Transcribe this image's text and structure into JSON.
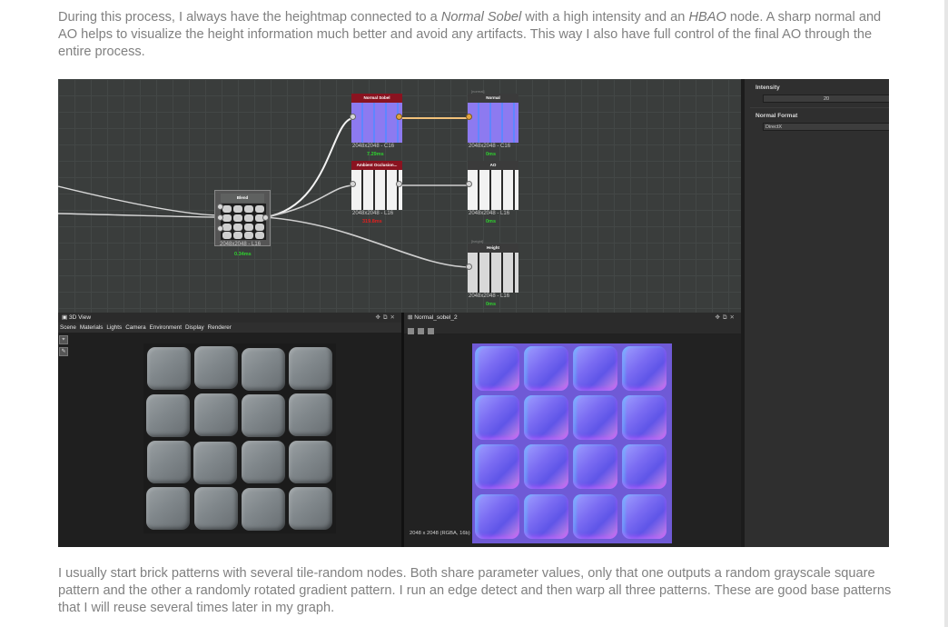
{
  "article": {
    "p1_pre": "During this process, I always have the heightmap connected to a ",
    "p1_em1": "Normal Sobel",
    "p1_mid": " with a high intensity and an ",
    "p1_em2": "HBAO",
    "p1_post": " node. A sharp normal and AO helps to visualize the height information much better and avoid any artifacts. This way I also have full control of the final AO through the entire process.",
    "p2": "I usually start brick patterns with several tile-random nodes. Both share parameter values, only that one outputs a random grayscale square pattern and the other a randomly rotated gradient pattern. I run an edge detect and then warp all three patterns. These are good base patterns that I will reuse several times later in my graph."
  },
  "graph": {
    "nodes": {
      "blend": {
        "title": "Blend",
        "res": "2048x2048 - L16",
        "time": "0.34ms"
      },
      "normal_sobel": {
        "title": "Normal Sobel",
        "res": "2048x2048 - C16",
        "time": "7.29ms"
      },
      "normal_out": {
        "title": "Normal",
        "tag": "[normal]",
        "res": "2048x2048 - C16",
        "time": "0ms"
      },
      "hbao": {
        "title": "Ambient Occlusion...",
        "res": "2048x2048 - L16",
        "time": "319.8ms"
      },
      "ao_out": {
        "title": "AO",
        "res": "2048x2048 - L16",
        "time": "0ms"
      },
      "height_out": {
        "title": "Height",
        "tag": "[height]",
        "res": "2048x2048 - L16",
        "time": "0ms"
      }
    },
    "colors": {
      "time_ok": "#2fd12f",
      "time_slow": "#e02020",
      "wire": "#e8e8e8",
      "wire_color": "#f2c27a"
    }
  },
  "params": {
    "intensity_label": "Intensity",
    "intensity_value": "20",
    "normal_format_label": "Normal Format",
    "normal_format_value": "DirectX"
  },
  "view3d": {
    "title": "3D View",
    "menu": [
      "Scene",
      "Materials",
      "Lights",
      "Camera",
      "Environment",
      "Display",
      "Renderer"
    ]
  },
  "view2d": {
    "title": "Normal_sobel_2",
    "info": "2048 x 2048 (RGBA, 16b)"
  }
}
